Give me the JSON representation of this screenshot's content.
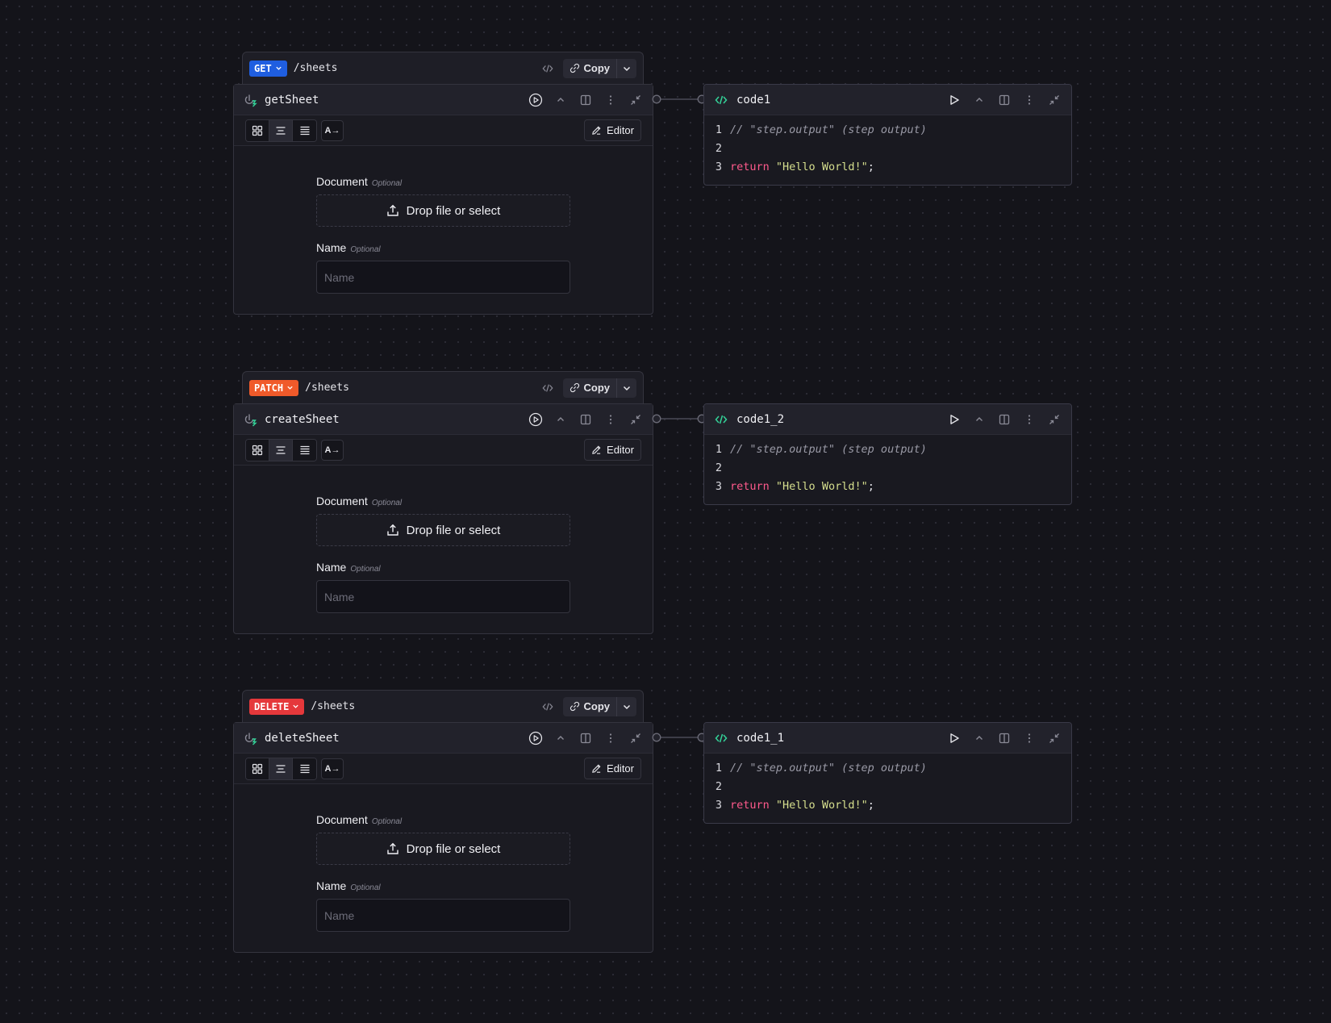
{
  "colors": {
    "get": "#1f5ee0",
    "patch": "#f05a2a",
    "delete": "#e5383b",
    "code_icon": "#34d399"
  },
  "icons": {
    "route": [
      "code-brackets-icon",
      "link-icon",
      "chevron-down-icon"
    ],
    "node_header": [
      "trigger-icon",
      "play-circle-icon",
      "chevron-up-icon",
      "split-panel-icon",
      "more-vertical-icon",
      "collapse-icon"
    ],
    "toolbar": [
      "grid-view-icon",
      "center-view-icon",
      "list-view-icon",
      "ai-translate-icon",
      "pencil-icon"
    ],
    "code_header": [
      "code-icon",
      "play-icon",
      "chevron-up-icon",
      "split-panel-icon",
      "more-vertical-icon",
      "collapse-icon"
    ],
    "field": [
      "upload-icon"
    ]
  },
  "route1": {
    "method": "GET",
    "path": "/sheets",
    "copy": "Copy"
  },
  "route2": {
    "method": "PATCH",
    "path": "/sheets",
    "copy": "Copy"
  },
  "route3": {
    "method": "DELETE",
    "path": "/sheets",
    "copy": "Copy"
  },
  "node1": {
    "title": "getSheet",
    "editor": "Editor",
    "ai_label": "A→",
    "document_label": "Document",
    "optional": "Optional",
    "drop_label": "Drop file or select",
    "name_label": "Name",
    "name_placeholder": "Name",
    "name_value": ""
  },
  "node2": {
    "title": "createSheet",
    "editor": "Editor",
    "ai_label": "A→",
    "document_label": "Document",
    "optional": "Optional",
    "drop_label": "Drop file or select",
    "name_label": "Name",
    "name_placeholder": "Name",
    "name_value": ""
  },
  "node3": {
    "title": "deleteSheet",
    "editor": "Editor",
    "ai_label": "A→",
    "document_label": "Document",
    "optional": "Optional",
    "drop_label": "Drop file or select",
    "name_label": "Name",
    "name_placeholder": "Name",
    "name_value": ""
  },
  "code1": {
    "title": "code1",
    "lines": {
      "n1": "1",
      "n2": "2",
      "n3": "3",
      "comment": "// \"step.output\" (step output)",
      "kw": "return",
      "str": "\"Hello World!\"",
      "punc": ";"
    }
  },
  "code2": {
    "title": "code1_2",
    "lines": {
      "n1": "1",
      "n2": "2",
      "n3": "3",
      "comment": "// \"step.output\" (step output)",
      "kw": "return",
      "str": "\"Hello World!\"",
      "punc": ";"
    }
  },
  "code3": {
    "title": "code1_1",
    "lines": {
      "n1": "1",
      "n2": "2",
      "n3": "3",
      "comment": "// \"step.output\" (step output)",
      "kw": "return",
      "str": "\"Hello World!\"",
      "punc": ";"
    }
  }
}
